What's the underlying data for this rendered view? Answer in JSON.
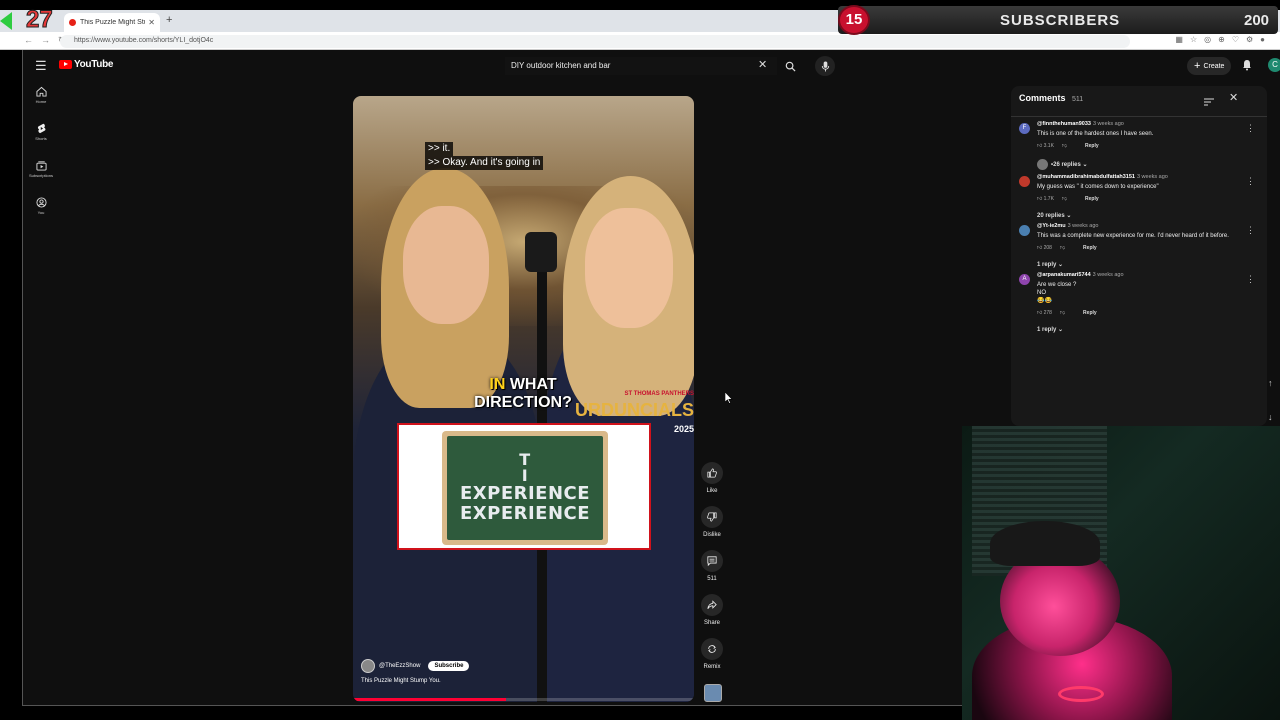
{
  "browser": {
    "tab_title": "This Puzzle Might Stump",
    "url": "https://www.youtube.com/shorts/YLI_dotjO4c"
  },
  "overlay": {
    "left_counter": "27",
    "subs_current": "15",
    "subs_label": "SUBSCRIBERS",
    "subs_goal": "200"
  },
  "youtube": {
    "logo_text": "YouTube",
    "search_value": "DIY outdoor kitchen and bar",
    "create_label": "Create",
    "avatar_letter": "C",
    "sidebar": [
      {
        "label": "Home",
        "icon": "home-icon"
      },
      {
        "label": "Shorts",
        "icon": "shorts-icon"
      },
      {
        "label": "Subscriptions",
        "icon": "subscriptions-icon"
      },
      {
        "label": "You",
        "icon": "you-icon"
      }
    ]
  },
  "video": {
    "caption_line1": ">> it.",
    "caption_line2": ">> Okay. And it's going in",
    "question_in": "IN",
    "question_rest": " WHAT",
    "question_line2": "DIRECTION?",
    "banner_small": "ST THOMAS PANTHERS",
    "banner_text": "URDUNCIALS",
    "banner_year": "2025",
    "board_line1": "T",
    "board_line2": "I",
    "board_line3": "EXPERIENCE",
    "board_line4": "EXPERIENCE",
    "channel": "@TheEzzShow",
    "subscribe_label": "Subscribe",
    "title": "This Puzzle Might Stump You.",
    "progress": 0.45
  },
  "actions": {
    "like": "Like",
    "dislike": "Dislike",
    "comments": "511",
    "share": "Share",
    "remix": "Remix"
  },
  "comments": {
    "title": "Comments",
    "count": "511",
    "items": [
      {
        "user": "@finnthehuman9033",
        "time": "3 weeks ago",
        "text": "This is one of the hardest ones I have seen.",
        "text2": "",
        "text3": "",
        "likes": "3.1K",
        "reply": "Reply",
        "replies": "26 replies",
        "avatar": "F",
        "color": "#5c6bc0"
      },
      {
        "user": "@muhammadibrahimabdulfattah3151",
        "time": "3 weeks ago",
        "text": "My guess was \" it comes down to experience\"",
        "text2": "",
        "text3": "",
        "likes": "1.7K",
        "reply": "Reply",
        "replies": "20 replies",
        "avatar": "",
        "color": "#c0392b"
      },
      {
        "user": "@Yt-ie2mu",
        "time": "3 weeks ago",
        "text": "This was a complete new experience for me. I'd never heard of it before.",
        "text2": "",
        "text3": "",
        "likes": "208",
        "reply": "Reply",
        "replies": "1 reply",
        "avatar": "",
        "color": "#4a7fb0"
      },
      {
        "user": "@arpanakumari5744",
        "time": "3 weeks ago",
        "text": "Are we close ?",
        "text2": "NO",
        "text3": "😂😂",
        "likes": "278",
        "reply": "Reply",
        "replies": "1 reply",
        "avatar": "A",
        "color": "#8e44ad"
      }
    ]
  }
}
